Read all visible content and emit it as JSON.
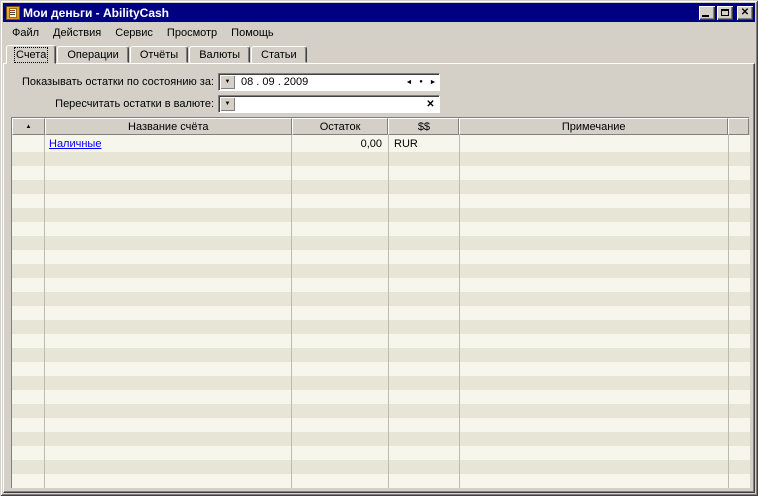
{
  "window": {
    "title": "Мои деньги - AbilityCash"
  },
  "icons": {
    "app": "ledger-icon",
    "dropdown": "▼",
    "spin_left": "◄",
    "spin_center": "●",
    "spin_right": "►",
    "clear": "✕",
    "close": "✕",
    "sort_asc": "▲"
  },
  "menu": {
    "items": [
      "Файл",
      "Действия",
      "Сервис",
      "Просмотр",
      "Помощь"
    ]
  },
  "tabs": {
    "items": [
      {
        "label": "Счета",
        "active": true
      },
      {
        "label": "Операции",
        "active": false
      },
      {
        "label": "Отчёты",
        "active": false
      },
      {
        "label": "Валюты",
        "active": false
      },
      {
        "label": "Статьи",
        "active": false
      }
    ]
  },
  "filters": {
    "date_label": "Показывать остатки по состоянию за:",
    "date_value": "08 . 09 . 2009",
    "currency_label": "Пересчитать остатки в валюте:",
    "currency_value": ""
  },
  "table": {
    "columns": [
      "",
      "Название счёта",
      "Остаток",
      "$$",
      "Примечание"
    ],
    "rows": [
      {
        "name": "Наличные",
        "balance": "0,00",
        "currency": "RUR",
        "note": ""
      }
    ]
  },
  "colors": {
    "titlebar": "#000082",
    "chrome": "#d4d0c8",
    "row_light": "#f7f6ec",
    "row_dark": "#e6e5d6",
    "grid_line": "#bcbcae",
    "link": "#0000ff"
  }
}
